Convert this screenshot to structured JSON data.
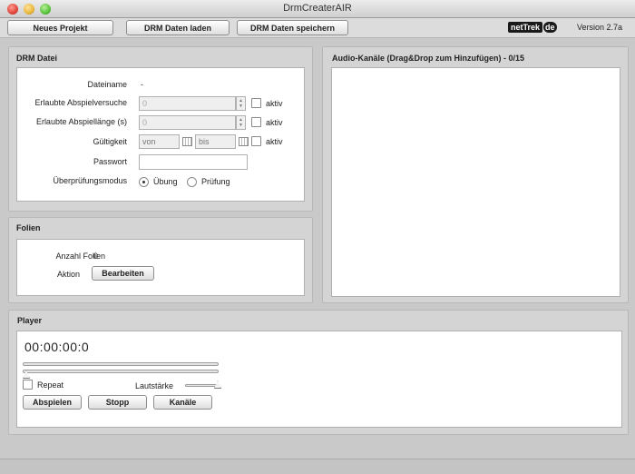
{
  "window": {
    "title": "DrmCreaterAIR"
  },
  "toolbar": {
    "new_project": "Neues Projekt",
    "load_drm": "DRM Daten laden",
    "save_drm": "DRM Daten speichern",
    "logo_net": "netTrek",
    "logo_de": "de",
    "version": "Version 2.7a"
  },
  "drm": {
    "title": "DRM Datei",
    "filename_label": "Dateiname",
    "filename_value": "-",
    "attempts_label": "Erlaubte Abspielversuche",
    "attempts_value": "0",
    "length_label": "Erlaubte Abspiellänge (s)",
    "length_value": "0",
    "validity_label": "Gültigkeit",
    "from_placeholder": "von",
    "to_placeholder": "bis",
    "active_label": "aktiv",
    "password_label": "Passwort",
    "password_value": "",
    "mode_label": "Überprüfungsmodus",
    "mode_practice": "Übung",
    "mode_exam": "Prüfung",
    "mode_selected": "Übung"
  },
  "slides": {
    "title": "Folien",
    "count_label": "Anzahl Folien",
    "count_value": "0",
    "action_label": "Aktion",
    "edit_button": "Bearbeiten"
  },
  "audio": {
    "title": "Audio-Kanäle (Drag&Drop zum Hinzufügen) - 0/15"
  },
  "player": {
    "title": "Player",
    "timecode": "00:00:00:0",
    "repeat_label": "Repeat",
    "repeat_checked": false,
    "volume_label": "Lautstärke",
    "volume_level": 1.0,
    "position_level": 0.0,
    "play_button": "Abspielen",
    "stop_button": "Stopp",
    "channels_button": "Kanäle"
  }
}
